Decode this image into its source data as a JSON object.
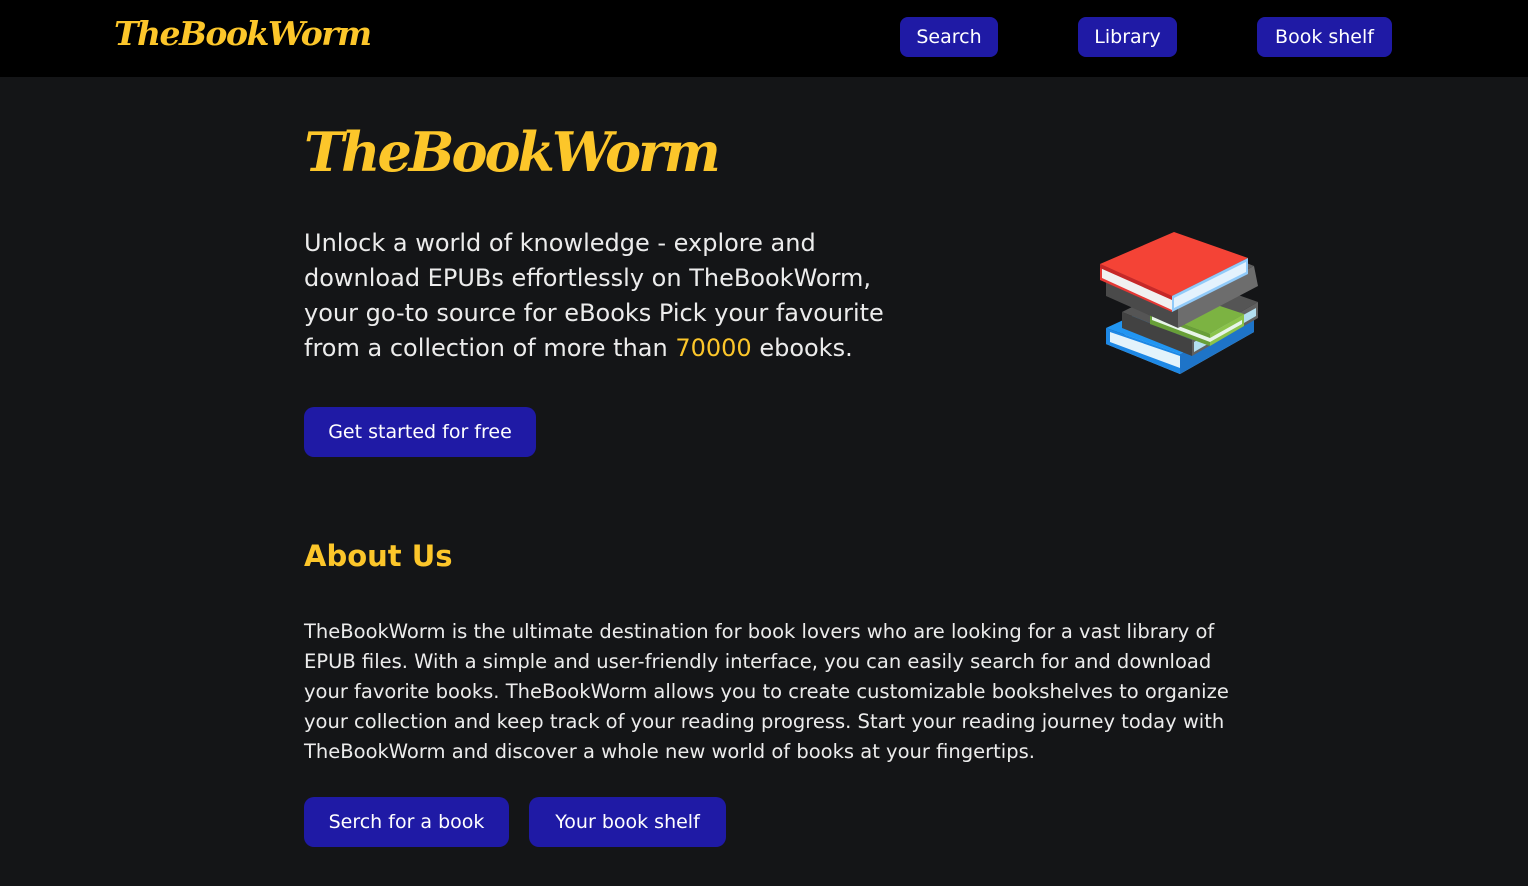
{
  "brand": {
    "name": "TheBookWorm",
    "color": "#fcc62a"
  },
  "nav": {
    "items": [
      {
        "label": "Search"
      },
      {
        "label": "Library"
      },
      {
        "label": "Book shelf"
      }
    ],
    "button_color": "#1f1aa5"
  },
  "hero": {
    "title": "TheBookWorm",
    "text_before": "Unlock a world of knowledge - explore and download EPUBs effortlessly on TheBookWorm, your go-to source for eBooks Pick your favourite from a collection of more than ",
    "highlight": "70000",
    "text_after": " ebooks.",
    "cta_label": "Get started for free",
    "image_icon": "stack-of-books-icon"
  },
  "about": {
    "title": "About Us",
    "text": "TheBookWorm is the ultimate destination for book lovers who are looking for a vast library of EPUB files. With a simple and user-friendly interface, you can easily search for and download your favorite books. TheBookWorm allows you to create customizable bookshelves to organize your collection and keep track of your reading progress. Start your reading journey today with TheBookWorm and discover a whole new world of books at your fingertips.",
    "buttons": [
      {
        "label": "Serch for a book"
      },
      {
        "label": "Your book shelf"
      }
    ]
  },
  "colors": {
    "background": "#141517",
    "navbar": "#000000",
    "accent": "#fcc62a",
    "button": "#1f1aa5",
    "text": "#ececec"
  }
}
